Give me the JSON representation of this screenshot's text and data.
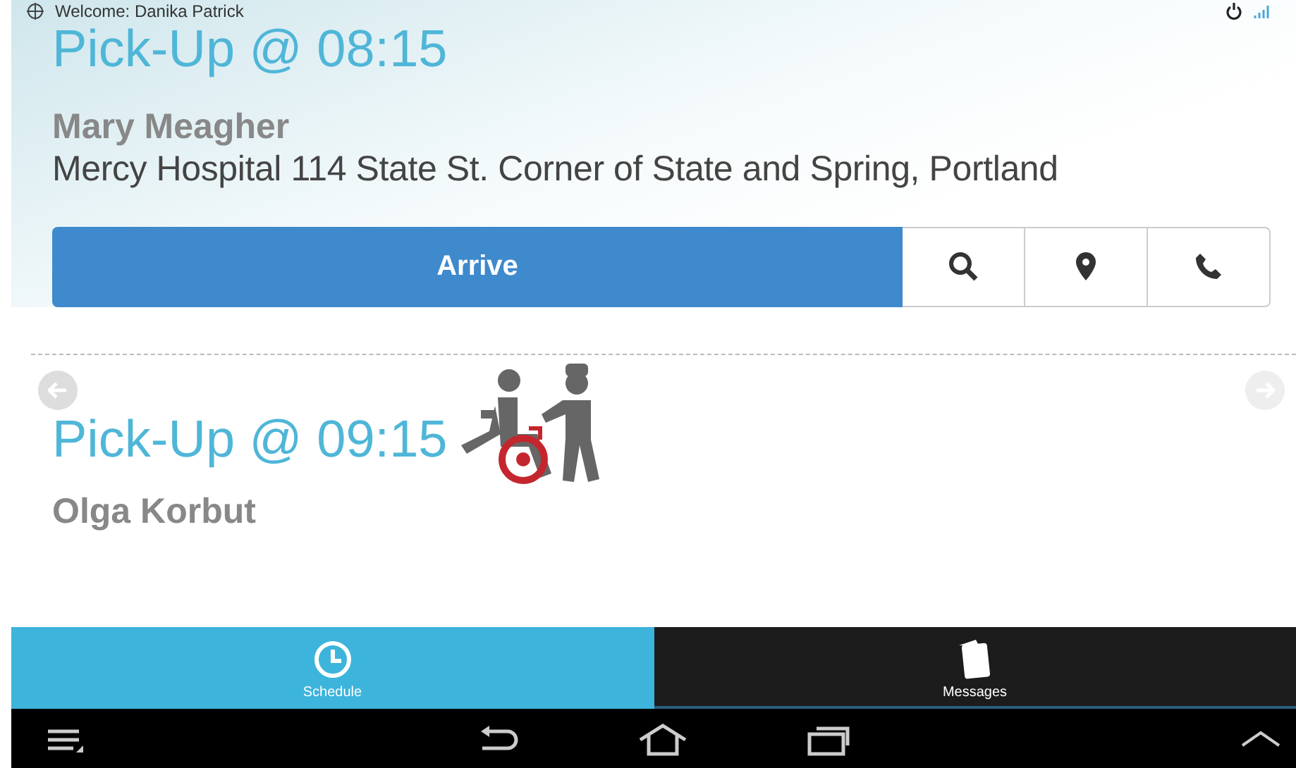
{
  "header": {
    "welcome": "Welcome: Danika Patrick"
  },
  "pickups": [
    {
      "time": "Pick-Up @ 08:15",
      "name": "Mary Meagher",
      "address": "Mercy Hospital 114 State St. Corner of State and Spring, Portland",
      "action": "Arrive",
      "wheelchair": false
    },
    {
      "time": "Pick-Up @ 09:15",
      "name": "Olga Korbut",
      "wheelchair": true
    }
  ],
  "tabs": [
    {
      "label": "Schedule",
      "selected": true
    },
    {
      "label": "Messages",
      "selected": false
    }
  ]
}
